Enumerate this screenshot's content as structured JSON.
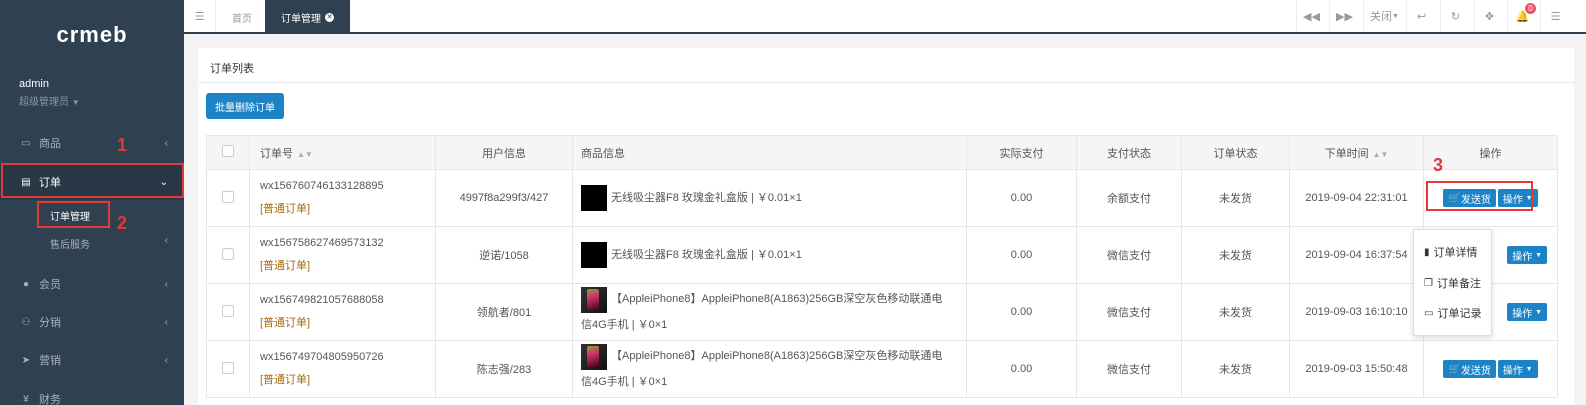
{
  "sidebar": {
    "logo": "crmeb",
    "profile": {
      "name": "admin",
      "role": "超级管理员"
    },
    "items": [
      {
        "label": "商品",
        "icon": "desktop-icon"
      },
      {
        "label": "订单",
        "icon": "file-icon"
      },
      {
        "label": "会员",
        "icon": "user-icon"
      },
      {
        "label": "分销",
        "icon": "users-icon"
      },
      {
        "label": "营销",
        "icon": "send-icon"
      },
      {
        "label": "财务",
        "icon": "money-icon"
      }
    ],
    "subitems": [
      {
        "label": "订单管理"
      },
      {
        "label": "售后服务"
      }
    ]
  },
  "annotations": {
    "n1": "1",
    "n2": "2",
    "n3": "3"
  },
  "topbar": {
    "tabs": [
      {
        "label": "首页"
      },
      {
        "label": "订单管理"
      }
    ],
    "close_label": "关闭",
    "badge": "0"
  },
  "panel": {
    "title": "订单列表",
    "bulk_delete": "批量删除订单",
    "columns": [
      "订单号",
      "用户信息",
      "商品信息",
      "实际支付",
      "支付状态",
      "订单状态",
      "下单时间",
      "操作"
    ],
    "ship_label": "发送货",
    "op_label": "操作",
    "rows": [
      {
        "order_no": "wx156760746133128895",
        "type": "[普通订单]",
        "user": "4997f8a299f3/427",
        "goods": "无线吸尘器F8 玫瑰金礼盒版 | ￥0.01×1",
        "paid": "0.00",
        "pay_status": "余额支付",
        "status": "未发货",
        "time": "2019-09-04 22:31:01"
      },
      {
        "order_no": "wx156758627469573132",
        "type": "[普通订单]",
        "user": "逆诺/1058",
        "goods": "无线吸尘器F8 玫瑰金礼盒版 | ￥0.01×1",
        "paid": "0.00",
        "pay_status": "微信支付",
        "status": "未发货",
        "time": "2019-09-04 16:37:54"
      },
      {
        "order_no": "wx156749821057688058",
        "type": "[普通订单]",
        "user": "领航者/801",
        "goods_line1": "【AppleiPhone8】AppleiPhone8(A1863)256GB深空灰色移动联通电",
        "goods_line2": "信4G手机 | ￥0×1",
        "paid": "0.00",
        "pay_status": "微信支付",
        "status": "未发货",
        "time": "2019-09-03 16:10:10"
      },
      {
        "order_no": "wx156749704805950726",
        "type": "[普通订单]",
        "user": "陈志强/283",
        "goods_line1": "【AppleiPhone8】AppleiPhone8(A1863)256GB深空灰色移动联通电",
        "goods_line2": "信4G手机 | ￥0×1",
        "paid": "0.00",
        "pay_status": "微信支付",
        "status": "未发货",
        "time": "2019-09-03 15:50:48"
      }
    ],
    "dropdown": [
      {
        "label": "订单详情",
        "icon": "file-icon"
      },
      {
        "label": "订单备注",
        "icon": "copy-icon"
      },
      {
        "label": "订单记录",
        "icon": "id-card-icon"
      }
    ]
  },
  "colors": {
    "sidebar": "#2f4050",
    "primary": "#1c84c6",
    "annotation": "#e53935",
    "order_type": "#a86b0c"
  }
}
